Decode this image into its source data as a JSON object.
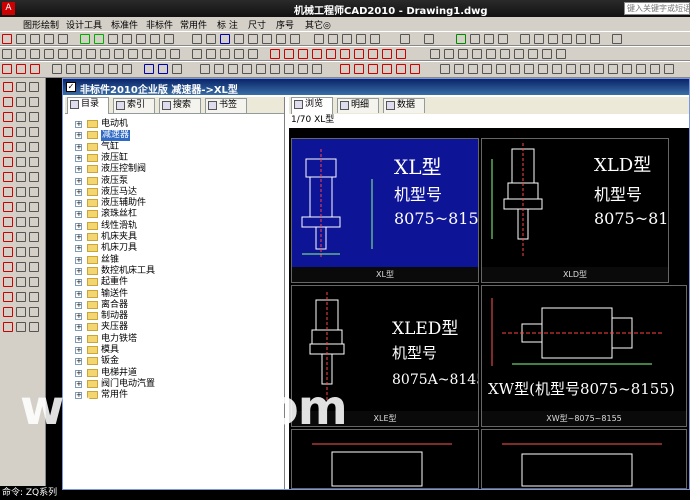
{
  "app": {
    "title": "机械工程师CAD2010 - Drawing1.dwg",
    "help_search_placeholder": "键入关键字或短语"
  },
  "menu": [
    "图形绘制",
    "设计工具",
    "标准件",
    "非标件",
    "常用件",
    "标 注",
    "尺寸",
    "序号",
    "其它◎"
  ],
  "dialog": {
    "title": "非标件2010企业版 减速器->XL型",
    "left_tabs": [
      "目录",
      "索引",
      "搜索",
      "书签"
    ],
    "right_tabs": [
      "浏览",
      "明细",
      "数据"
    ],
    "path": "1/70 XL型",
    "tree": [
      {
        "label": "电动机",
        "selected": false
      },
      {
        "label": "减速器",
        "selected": true
      },
      {
        "label": "气缸",
        "selected": false
      },
      {
        "label": "液压缸",
        "selected": false
      },
      {
        "label": "液压控制阀",
        "selected": false
      },
      {
        "label": "液压泵",
        "selected": false
      },
      {
        "label": "液压马达",
        "selected": false
      },
      {
        "label": "液压辅助件",
        "selected": false
      },
      {
        "label": "滚珠丝杠",
        "selected": false
      },
      {
        "label": "线性滑轨",
        "selected": false
      },
      {
        "label": "机床夹具",
        "selected": false
      },
      {
        "label": "机床刀具",
        "selected": false
      },
      {
        "label": "丝锥",
        "selected": false
      },
      {
        "label": "数控机床工具",
        "selected": false
      },
      {
        "label": "起重件",
        "selected": false
      },
      {
        "label": "输送件",
        "selected": false
      },
      {
        "label": "离合器",
        "selected": false
      },
      {
        "label": "制动器",
        "selected": false
      },
      {
        "label": "夹压器",
        "selected": false
      },
      {
        "label": "电力铁塔",
        "selected": false
      },
      {
        "label": "模具",
        "selected": false
      },
      {
        "label": "钣金",
        "selected": false
      },
      {
        "label": "电梯井道",
        "selected": false
      },
      {
        "label": "阀门电动汽置",
        "selected": false
      },
      {
        "label": "常用件",
        "selected": false
      }
    ],
    "cards": [
      {
        "caption": "XL型",
        "big": "XL型",
        "sub": "机型号",
        "range": "8075~8155",
        "selected": true
      },
      {
        "caption": "XLD型",
        "big": "XLD型",
        "sub": "机型号",
        "range": "8075~8155",
        "selected": false
      },
      {
        "caption": "XLE型",
        "big": "XLED型",
        "sub": "机型号",
        "range": "8075A~8145C",
        "selected": false
      },
      {
        "caption": "XW型~8075~8155",
        "big": "XW型(机型号8075~8155)",
        "sub": "",
        "range": "",
        "selected": false
      }
    ]
  },
  "watermark": "www.xz.com",
  "command_line": "命令: ZQ系列"
}
